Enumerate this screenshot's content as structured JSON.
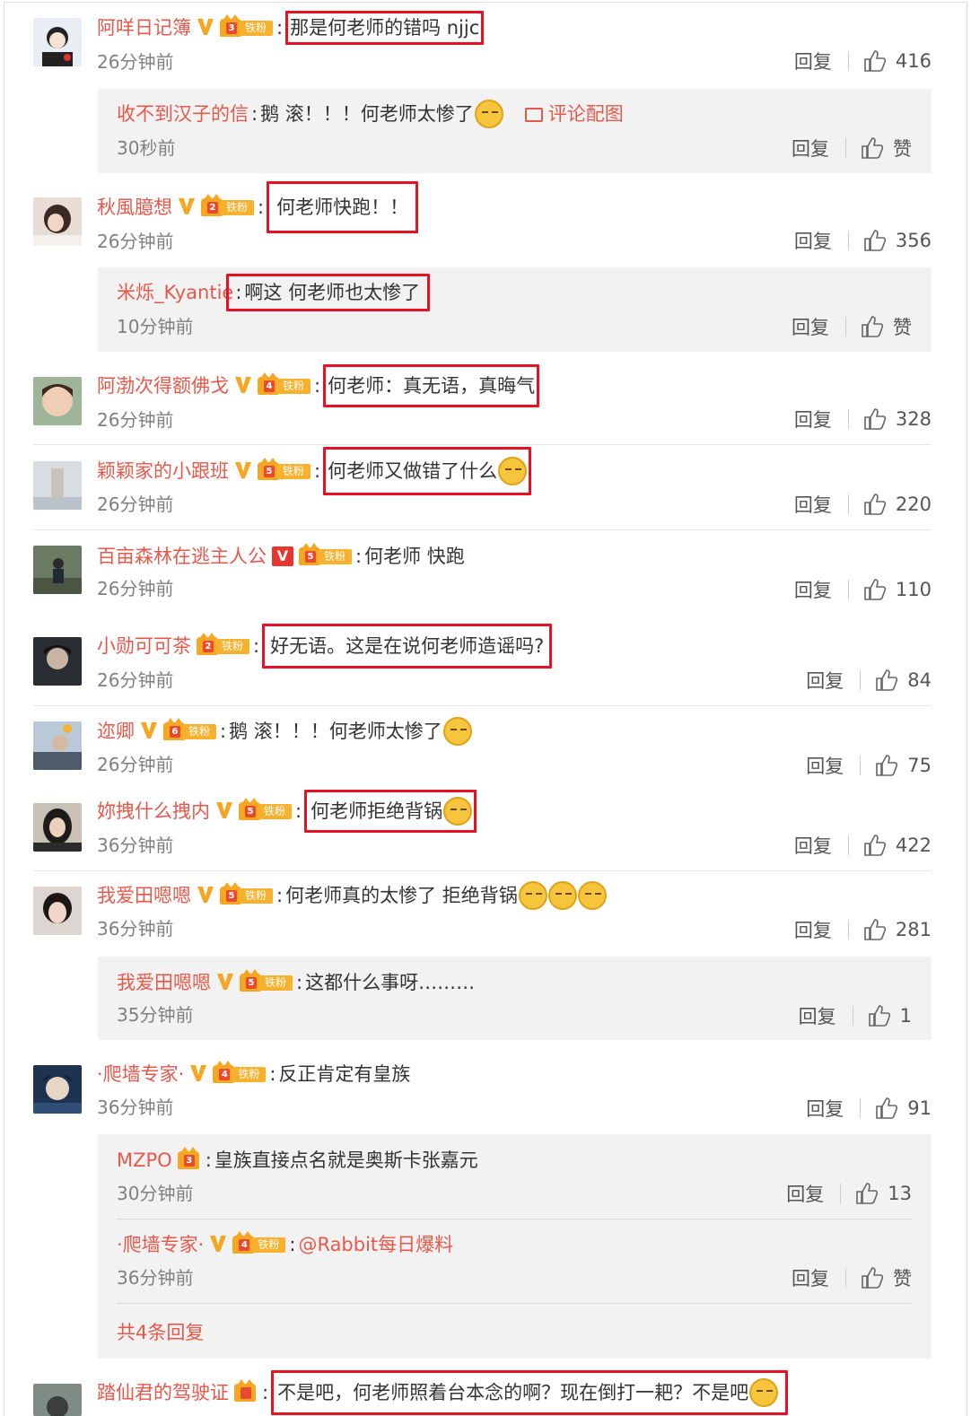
{
  "comments": [
    {
      "name": "阿咩日记簿",
      "verified": true,
      "fan_level": "3",
      "fan_label": "铁粉",
      "text": "那是何老师的错吗 njjc",
      "boxed": true,
      "time": "26分钟前",
      "reply": "回复",
      "likes": "416",
      "subs": [
        {
          "name": "收不到汉子的信",
          "text": "鹅 滚！！！何老师太惨了",
          "image_link": "评论配图",
          "time": "30秒前",
          "reply": "回复",
          "likes": "赞"
        }
      ]
    },
    {
      "name": "秋風臆想",
      "verified": true,
      "fan_level": "2",
      "fan_label": "铁粉",
      "text": "何老师快跑！！",
      "boxed": true,
      "time": "26分钟前",
      "reply": "回复",
      "likes": "356",
      "subs": [
        {
          "name": "米烁_Kyantie",
          "text": "啊这 何老师也太惨了",
          "time": "10分钟前",
          "reply": "回复",
          "likes": "赞"
        }
      ]
    },
    {
      "name": "阿渤次得额佛戈",
      "verified": true,
      "fan_level": "4",
      "fan_label": "铁粉",
      "text": "何老师：真无语，真晦气",
      "boxed": true,
      "time": "26分钟前",
      "reply": "回复",
      "likes": "328"
    },
    {
      "name": "颖颖家的小跟班",
      "verified": true,
      "fan_level": "5",
      "fan_label": "铁粉",
      "text": "何老师又做错了什么",
      "boxed": true,
      "time": "26分钟前",
      "reply": "回复",
      "likes": "220"
    },
    {
      "name": "百亩森林在逃主人公",
      "verified": true,
      "verified_red": true,
      "fan_level": "5",
      "fan_label": "铁粉",
      "text": "何老师 快跑",
      "boxed": false,
      "time": "26分钟前",
      "reply": "回复",
      "likes": "110"
    },
    {
      "name": "小勋可可茶",
      "verified": false,
      "fan_level": "2",
      "fan_label": "铁粉",
      "text": "好无语。这是在说何老师造谣吗?",
      "boxed": true,
      "time": "26分钟前",
      "reply": "回复",
      "likes": "84"
    },
    {
      "name": "迩卿",
      "verified": true,
      "fan_level": "6",
      "fan_label": "铁粉",
      "text": "鹅 滚！！！何老师太惨了",
      "boxed": false,
      "time": "26分钟前",
      "reply": "回复",
      "likes": "75"
    },
    {
      "name": "妳拽什么拽内",
      "verified": true,
      "fan_level": "5",
      "fan_label": "铁粉",
      "text": "何老师拒绝背锅",
      "boxed": true,
      "time": "36分钟前",
      "reply": "回复",
      "likes": "422"
    },
    {
      "name": "我爱田嗯嗯",
      "verified": true,
      "fan_level": "5",
      "fan_label": "铁粉",
      "text": "何老师真的太惨了 拒绝背锅",
      "boxed": false,
      "time": "36分钟前",
      "reply": "回复",
      "likes": "281",
      "subs": [
        {
          "name": "我爱田嗯嗯",
          "verified": true,
          "fan_level": "5",
          "fan_label": "铁粉",
          "text": "这都什么事呀………",
          "time": "35分钟前",
          "reply": "回复",
          "likes": "1"
        }
      ]
    },
    {
      "name": "·爬墙专家·",
      "verified": true,
      "fan_level": "4",
      "fan_label": "铁粉",
      "text": "反正肯定有皇族",
      "boxed": false,
      "time": "36分钟前",
      "reply": "回复",
      "likes": "91",
      "subs": [
        {
          "name": "MZPO",
          "fan_level": "3",
          "text": "皇族直接点名就是奥斯卡张嘉元",
          "time": "30分钟前",
          "reply": "回复",
          "likes": "13"
        },
        {
          "name": "·爬墙专家·",
          "verified": true,
          "fan_level": "4",
          "fan_label": "铁粉",
          "text": "@Rabbit每日爆料",
          "time": "36分钟前",
          "reply": "回复",
          "likes": "赞"
        }
      ],
      "more_replies": "共4条回复"
    },
    {
      "name": "踏仙君的驾驶证",
      "fan_level": "",
      "text": "不是吧，何老师照着台本念的啊？现在倒打一耙？不是吧",
      "boxed": true
    }
  ]
}
